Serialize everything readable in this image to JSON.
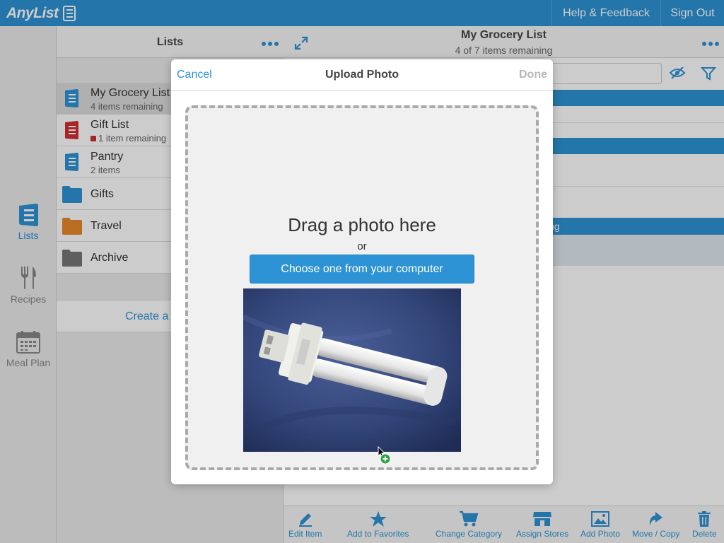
{
  "app": {
    "logo_text": "AnyList"
  },
  "topbar": {
    "help_label": "Help & Feedback",
    "signout_label": "Sign Out"
  },
  "leftnav": {
    "items": [
      {
        "label": "Lists"
      },
      {
        "label": "Recipes"
      },
      {
        "label": "Meal Plan"
      }
    ]
  },
  "lists_panel": {
    "title": "Lists",
    "lists": [
      {
        "name": "My Grocery List",
        "subtitle": "4 items remaining",
        "color": "#2e93d5"
      },
      {
        "name": "Gift List",
        "subtitle": "1 item remaining",
        "color": "#d32f2f"
      },
      {
        "name": "Pantry",
        "subtitle": "2 items",
        "color": "#2e93d5"
      }
    ],
    "folders": [
      {
        "name": "Gifts",
        "color": "#2e93d5"
      },
      {
        "name": "Travel",
        "color": "#e8892a"
      },
      {
        "name": "Archive",
        "color": "#777777"
      }
    ],
    "create_label": "Create a"
  },
  "list_panel": {
    "title": "My Grocery List",
    "subtitle": "4 of 7 items remaining",
    "partial_band_text": "ng"
  },
  "toolbar": {
    "items": [
      {
        "label": "Edit Item"
      },
      {
        "label": "Add to Favorites"
      },
      {
        "label": "Change Category"
      },
      {
        "label": "Assign Stores"
      },
      {
        "label": "Add Photo"
      },
      {
        "label": "Move / Copy"
      },
      {
        "label": "Delete"
      }
    ]
  },
  "modal": {
    "cancel_label": "Cancel",
    "title": "Upload Photo",
    "done_label": "Done",
    "drop_title": "Drag a photo here",
    "or_text": "or",
    "choose_label": "Choose one from your computer"
  },
  "colors": {
    "accent": "#2e93d5",
    "red": "#d32f2f",
    "orange": "#e8892a",
    "gray": "#777777"
  }
}
